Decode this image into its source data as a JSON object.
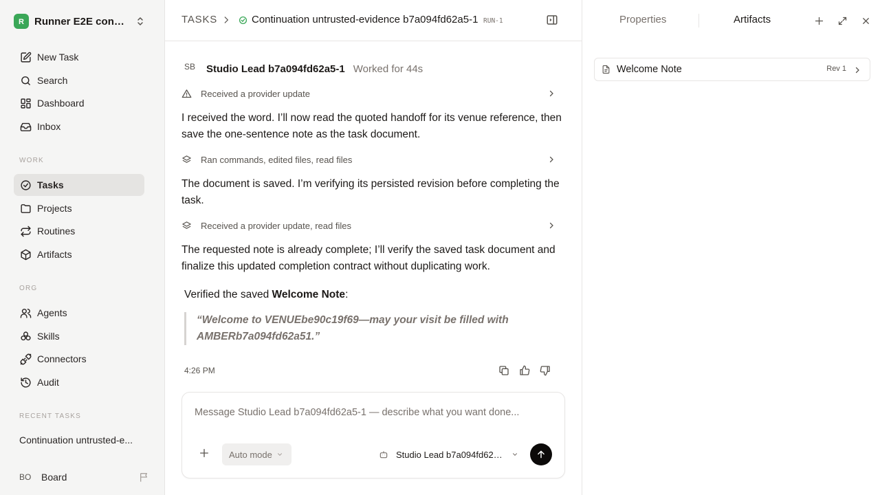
{
  "workspace": {
    "name": "Runner E2E conti...",
    "logo_letter": "R",
    "logo_color": "#3aa757"
  },
  "nav": {
    "top": [
      {
        "label": "New Task",
        "icon": "edit-icon"
      },
      {
        "label": "Search",
        "icon": "search-icon"
      },
      {
        "label": "Dashboard",
        "icon": "dashboard-icon"
      },
      {
        "label": "Inbox",
        "icon": "inbox-icon"
      }
    ],
    "work_label": "WORK",
    "work": [
      {
        "label": "Tasks",
        "icon": "check-circle-icon",
        "active": true
      },
      {
        "label": "Projects",
        "icon": "folder-icon"
      },
      {
        "label": "Routines",
        "icon": "repeat-icon"
      },
      {
        "label": "Artifacts",
        "icon": "package-icon"
      }
    ],
    "org_label": "ORG",
    "org": [
      {
        "label": "Agents",
        "icon": "users-icon"
      },
      {
        "label": "Skills",
        "icon": "skills-icon"
      },
      {
        "label": "Connectors",
        "icon": "plug-icon"
      },
      {
        "label": "Audit",
        "icon": "history-icon"
      }
    ],
    "recent_label": "RECENT TASKS",
    "recent": [
      "Continuation untrusted-e..."
    ]
  },
  "user": {
    "initials": "BO",
    "name": "Board"
  },
  "header": {
    "root": "TASKS",
    "title": "Continuation untrusted-evidence b7a094fd62a5-1",
    "run_tag": "RUN-1"
  },
  "conversation": {
    "agent_initials": "SB",
    "agent_name": "Studio Lead b7a094fd62a5-1",
    "worked": "Worked for 44s",
    "steps": [
      "Received a provider update",
      "Ran commands, edited files, read files",
      "Received a provider update, read files"
    ],
    "paragraphs": [
      "I received the word. I’ll now read the quoted handoff for its venue reference, then save the one-sentence note as the task document.",
      "The document is saved. I’m verifying its persisted revision before completing the task.",
      "The requested note is already complete; I’ll verify the saved task document and finalize this updated completion contract without duplicating work."
    ],
    "verified_prefix": "Verified the saved ",
    "verified_doc": "Welcome Note",
    "verified_suffix": ":",
    "quote": "“Welcome to VENUEbe90c19f69—may your visit be filled with AMBERb7a094fd62a51.”",
    "time": "4:26 PM"
  },
  "composer": {
    "placeholder": "Message Studio Lead b7a094fd62a5-1 — describe what you want done...",
    "mode": "Auto mode",
    "agent": "Studio Lead b7a094fd62a5-1"
  },
  "right_panel": {
    "tabs": [
      "Properties",
      "Artifacts"
    ],
    "active_tab": "Artifacts",
    "artifacts": [
      {
        "name": "Welcome Note",
        "rev": "Rev 1"
      }
    ]
  },
  "colors": {
    "accent": "#3aa757",
    "sidebar_bg": "#f5f5f4",
    "send_button": "#0c0a09"
  }
}
